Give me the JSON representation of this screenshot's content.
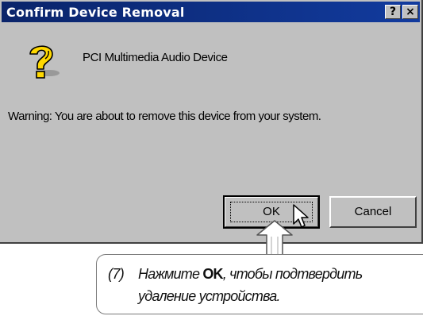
{
  "dialog": {
    "title": "Confirm Device Removal",
    "help_label": "?",
    "close_label": "×",
    "icon": "question-icon",
    "device_name": "PCI Multimedia Audio Device",
    "warning": "Warning: You are about to remove this device from your system.",
    "ok_label": "OK",
    "cancel_label": "Cancel"
  },
  "callout": {
    "step": "(7)",
    "pre": "Нажмите",
    "bold": "OK",
    "post": ", чтобы подтвердить",
    "line2": "удаление устройства."
  },
  "colors": {
    "titlebar": "#0a246a",
    "dialog_face": "#c0c0c0",
    "icon_yellow": "#ffd800"
  }
}
